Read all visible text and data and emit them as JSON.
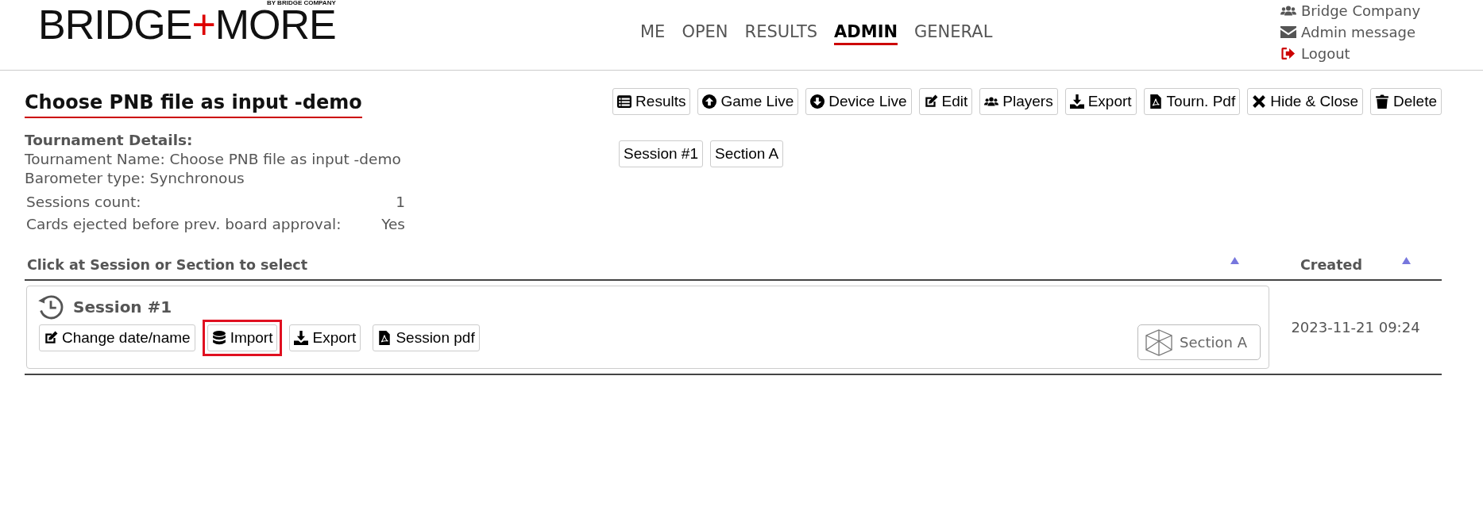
{
  "logo": {
    "left": "BRIDGE",
    "mark": "+",
    "right": "MORE",
    "tagline": "BY BRIDGE COMPANY"
  },
  "nav": [
    {
      "label": "ME",
      "selected": false
    },
    {
      "label": "OPEN",
      "selected": false
    },
    {
      "label": "RESULTS",
      "selected": false
    },
    {
      "label": "ADMIN",
      "selected": true
    },
    {
      "label": "GENERAL",
      "selected": false
    }
  ],
  "user_menu": [
    "Bridge Company",
    "Admin message",
    "Logout"
  ],
  "title": "Choose PNB file as input -demo",
  "toolbar": [
    "Results",
    "Game Live",
    "Device Live",
    "Edit",
    "Players",
    "Export",
    "Tourn. Pdf",
    "Hide & Close",
    "Delete"
  ],
  "filters": [
    "Session #1",
    "Section A"
  ],
  "details": {
    "heading": "Tournament Details:",
    "lines": [
      "Tournament Name: Choose PNB file as input -demo",
      "Barometer type: Synchronous"
    ],
    "rows": [
      {
        "label": "Sessions count:",
        "value": "1"
      },
      {
        "label": "Cards ejected before prev. board approval:",
        "value": "Yes"
      }
    ]
  },
  "table": {
    "columns": [
      "Click at Session or Section to select",
      "Created"
    ],
    "rows": [
      {
        "session": "Session #1",
        "buttons": [
          {
            "label": "Change date/name",
            "highlighted": false
          },
          {
            "label": "Import",
            "highlighted": true
          },
          {
            "label": "Export",
            "highlighted": false
          },
          {
            "label": "Session pdf",
            "highlighted": false
          }
        ],
        "section": "Section A",
        "created": "2023-11-21 09:24"
      }
    ]
  }
}
